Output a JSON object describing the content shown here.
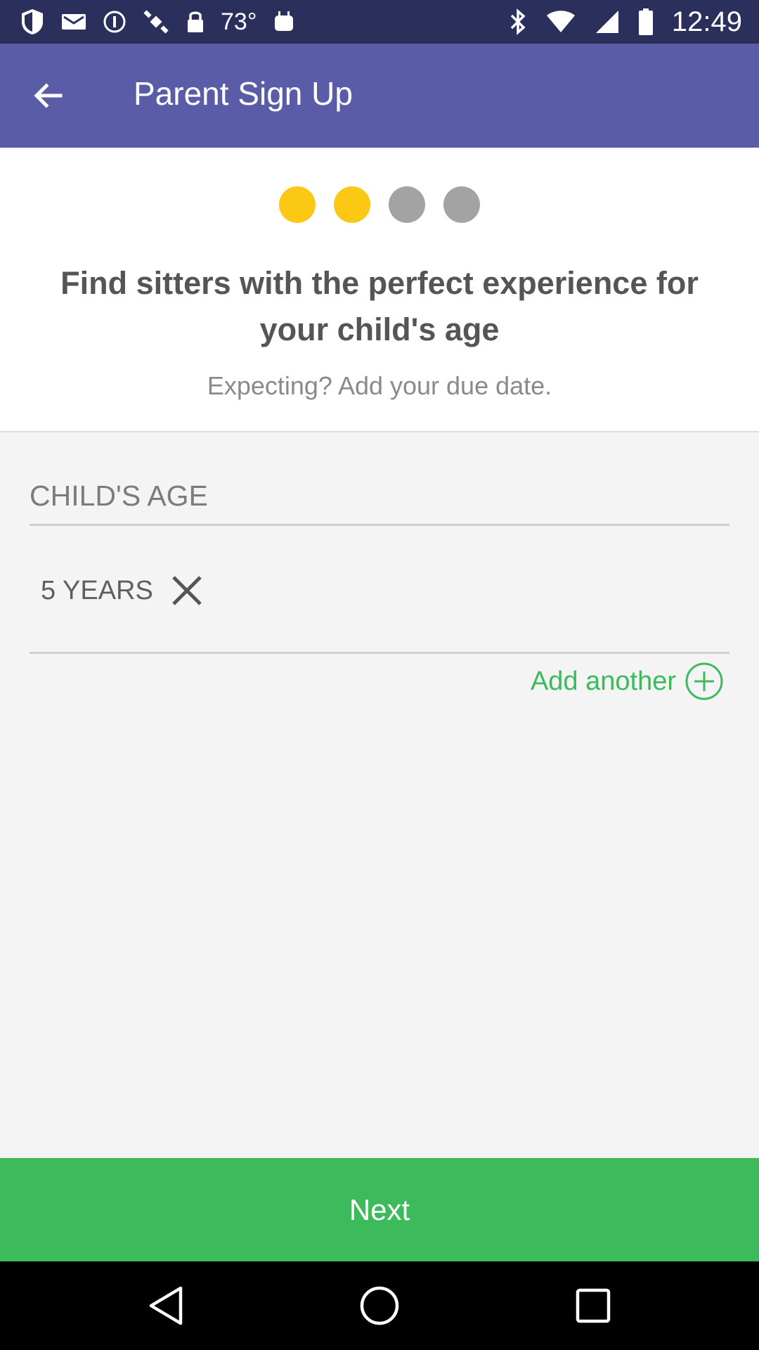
{
  "status_bar": {
    "temperature": "73°",
    "time": "12:49",
    "icons": [
      "shield-icon",
      "mail-icon",
      "info-icon",
      "satellite-icon",
      "lock-icon",
      "temperature-text",
      "android-icon",
      "bluetooth-icon",
      "wifi-icon",
      "signal-icon",
      "battery-icon"
    ]
  },
  "app_bar": {
    "title": "Parent Sign Up",
    "back_icon": "arrow-left-icon"
  },
  "progress": {
    "total_steps": 4,
    "completed_steps": 2,
    "active_color": "#fbc813",
    "inactive_color": "#a3a3a3"
  },
  "header": {
    "headline": "Find sitters with the perfect experience for your child's age",
    "subtext": "Expecting? Add your due date."
  },
  "form": {
    "child_age_label": "CHILD'S AGE",
    "ages": [
      {
        "label": "5 YEARS"
      }
    ],
    "add_another_label": "Add another"
  },
  "footer": {
    "next_label": "Next"
  },
  "colors": {
    "app_bar": "#5b5ca8",
    "status_bar": "#2b2f5b",
    "accent_green": "#3dba5b",
    "accent_yellow": "#fbc813"
  }
}
